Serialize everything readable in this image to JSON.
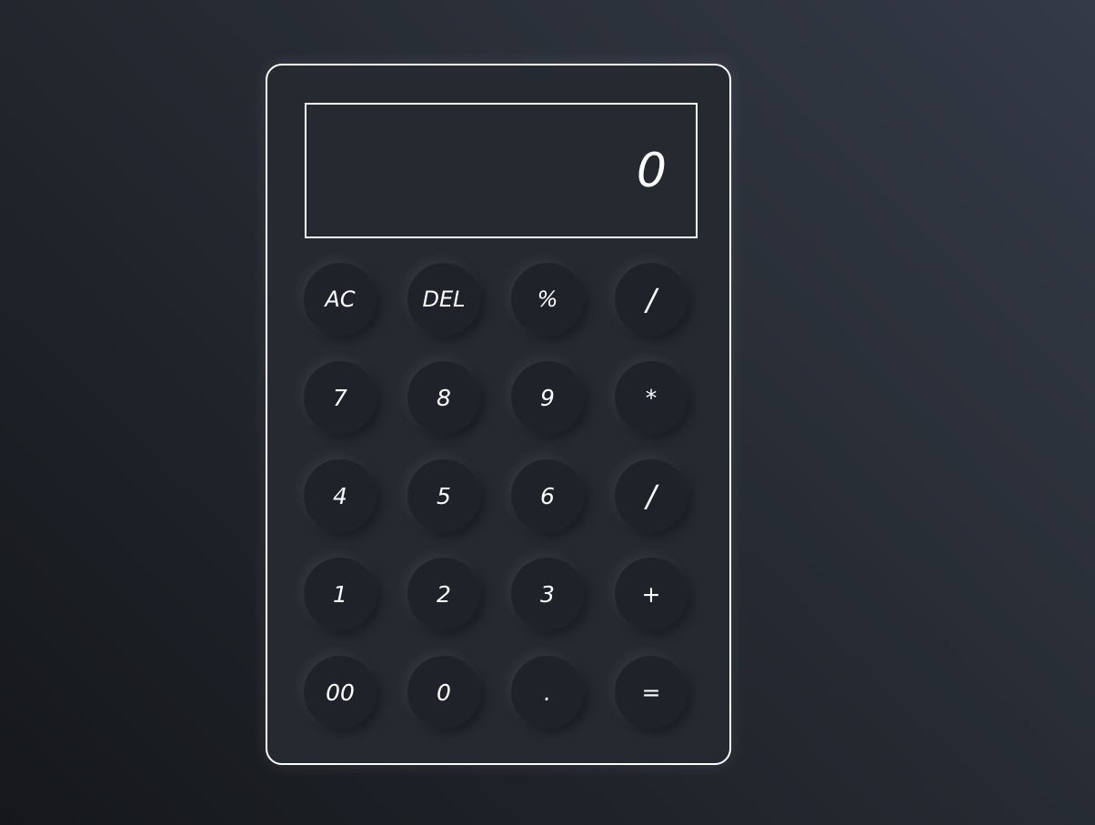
{
  "display": {
    "value": "0"
  },
  "keys": [
    {
      "label": "AC"
    },
    {
      "label": "DEL"
    },
    {
      "label": "%"
    },
    {
      "label": "/"
    },
    {
      "label": "7"
    },
    {
      "label": "8"
    },
    {
      "label": "9"
    },
    {
      "label": "*"
    },
    {
      "label": "4"
    },
    {
      "label": "5"
    },
    {
      "label": "6"
    },
    {
      "label": "/"
    },
    {
      "label": "1"
    },
    {
      "label": "2"
    },
    {
      "label": "3"
    },
    {
      "label": "+"
    },
    {
      "label": "00"
    },
    {
      "label": "0"
    },
    {
      "label": "."
    },
    {
      "label": "="
    }
  ]
}
